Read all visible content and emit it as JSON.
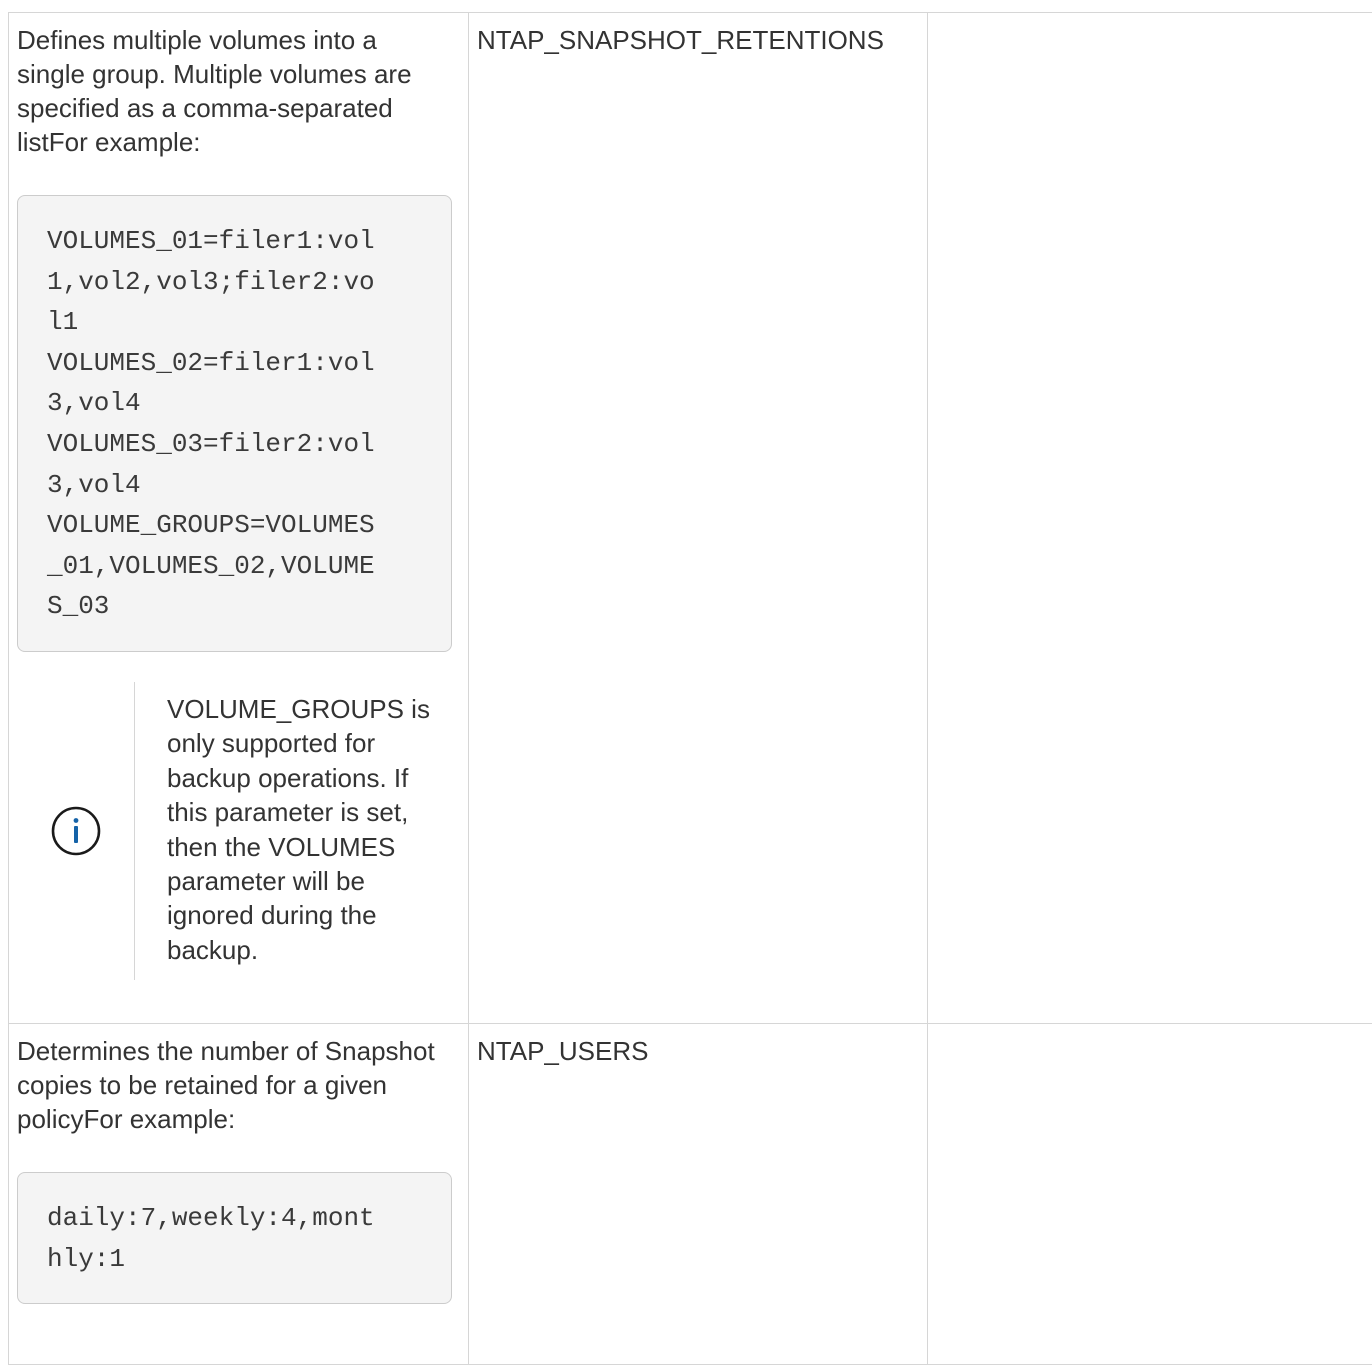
{
  "rows": [
    {
      "description": "Defines multiple volumes into a single group. Multiple volumes are specified as a comma-separated listFor example:",
      "code_lines": [
        "VOLUMES_01=filer1:vol",
        "1,vol2,vol3;filer2:vo",
        "l1",
        "VOLUMES_02=filer1:vol",
        "3,vol4",
        "VOLUMES_03=filer2:vol",
        "3,vol4",
        "VOLUME_GROUPS=VOLUMES",
        "_01,VOLUMES_02,VOLUME",
        "S_03"
      ],
      "note": {
        "icon": "info-icon",
        "text": "VOLUME_GROUPS is only supported for backup operations. If this parameter is set, then the VOLUMES parameter will be ignored during the backup."
      },
      "parameter": "NTAP_SNAPSHOT_RETENTIONS",
      "third": ""
    },
    {
      "description": "Determines the number of Snapshot copies to be retained for a given policyFor example:",
      "code_lines": [
        "daily:7,weekly:4,mont",
        "hly:1"
      ],
      "parameter": "NTAP_USERS",
      "third": ""
    }
  ],
  "colors": {
    "border": "#d6d6d6",
    "code_background": "#f4f4f4",
    "info_icon": "#1563a8",
    "text": "#333333"
  }
}
